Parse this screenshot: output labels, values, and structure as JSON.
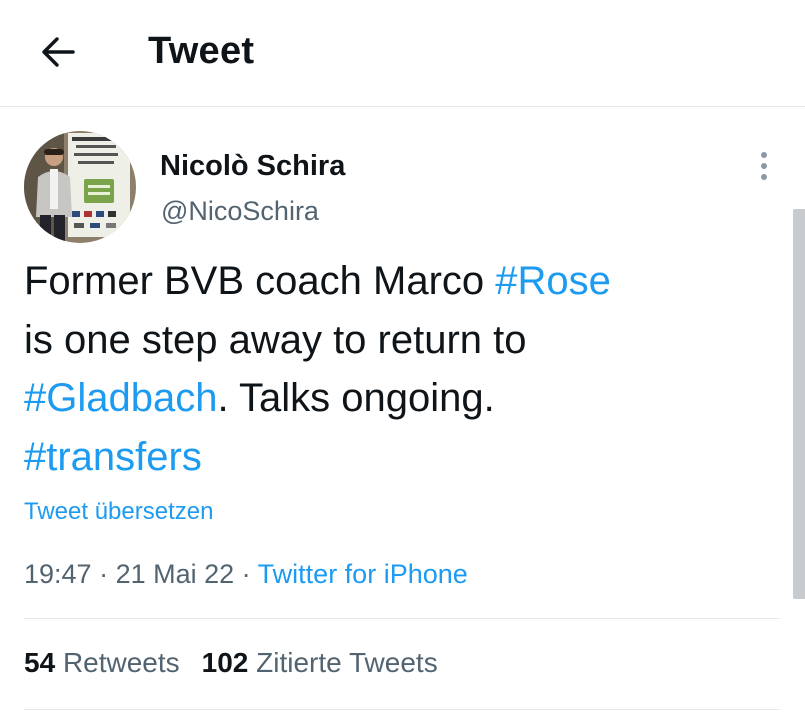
{
  "header": {
    "title": "Tweet",
    "back_icon": "arrow-left-icon"
  },
  "author": {
    "name": "Nicolò Schira",
    "handle": "@NicoSchira"
  },
  "tweet": {
    "segments": [
      {
        "text": "Former BVB coach Marco ",
        "hashtag": false
      },
      {
        "text": "#Rose",
        "hashtag": true
      },
      {
        "text": "is one step away to return to",
        "hashtag": false
      },
      {
        "text": "#Gladbach",
        "hashtag": true
      },
      {
        "text": ". Talks ongoing.",
        "hashtag": false
      },
      {
        "text": "#transfers",
        "hashtag": true
      }
    ],
    "translate_label": "Tweet übersetzen"
  },
  "meta": {
    "time": "19:47",
    "separator": " · ",
    "date": "21 Mai 22",
    "source": "Twitter for iPhone"
  },
  "stats": {
    "retweets_count": "54",
    "retweets_label": "Retweets",
    "quotes_count": "102",
    "quotes_label": "Zitierte Tweets"
  },
  "colors": {
    "link": "#1d9bf0",
    "secondary_text": "#536471",
    "primary_text": "#0f1419",
    "divider": "#e6e8ea"
  }
}
